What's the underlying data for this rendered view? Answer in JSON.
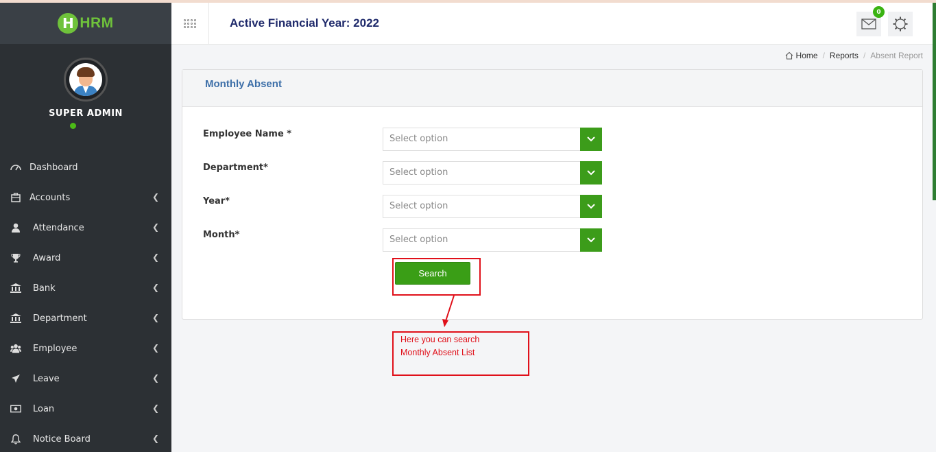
{
  "app": {
    "logo_letter": "H",
    "logo_text": "HRM",
    "financial_year_title": "Active Financial Year: 2022"
  },
  "user": {
    "name": "SUPER ADMIN",
    "status": "online"
  },
  "sidebar": {
    "items": [
      {
        "label": "Dashboard",
        "icon": "dashboard-icon",
        "chevron": false
      },
      {
        "label": "Accounts",
        "icon": "briefcase-icon",
        "chevron": true
      },
      {
        "label": "Attendance",
        "icon": "user-icon",
        "chevron": true
      },
      {
        "label": "Award",
        "icon": "trophy-icon",
        "chevron": true
      },
      {
        "label": "Bank",
        "icon": "bank-icon",
        "chevron": true
      },
      {
        "label": "Department",
        "icon": "institution-icon",
        "chevron": true
      },
      {
        "label": "Employee",
        "icon": "users-icon",
        "chevron": true
      },
      {
        "label": "Leave",
        "icon": "plane-icon",
        "chevron": true
      },
      {
        "label": "Loan",
        "icon": "money-icon",
        "chevron": true
      },
      {
        "label": "Notice Board",
        "icon": "bell-icon",
        "chevron": true
      }
    ]
  },
  "header": {
    "mail_count": "0"
  },
  "breadcrumb": {
    "home": "Home",
    "reports": "Reports",
    "current": "Absent Report"
  },
  "panel": {
    "title": "Monthly Absent",
    "fields": [
      {
        "label": "Employee Name *",
        "placeholder": "Select option"
      },
      {
        "label": "Department*",
        "placeholder": "Select option"
      },
      {
        "label": "Year*",
        "placeholder": "Select option"
      },
      {
        "label": "Month*",
        "placeholder": "Select option"
      }
    ],
    "search_label": "Search"
  },
  "annotation": {
    "line1": "Here you can search",
    "line2": "Monthly Absent List"
  },
  "colors": {
    "sidebar_bg": "#2c3034",
    "brand_green": "#6fc23b",
    "button_green": "#3a9e16",
    "title_blue": "#3d6fa8",
    "annotation_red": "#e0101a"
  }
}
